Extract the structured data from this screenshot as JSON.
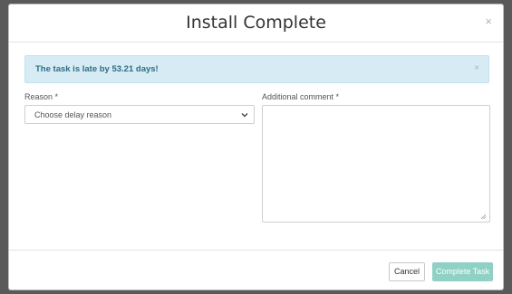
{
  "modal": {
    "title": "Install Complete",
    "close_glyph": "×"
  },
  "alert": {
    "message": "The task is late by 53.21 days!",
    "close_glyph": "×",
    "background_color": "#d6ebf3",
    "text_color": "#2e6d86"
  },
  "form": {
    "reason_label": "Reason *",
    "reason_selected": "Choose delay reason",
    "comment_label": "Additional comment *",
    "comment_value": ""
  },
  "footer": {
    "cancel_label": "Cancel",
    "complete_label": "Complete Task",
    "complete_color": "#8fd1c5"
  },
  "icons": {
    "select_chevron": "chevron-down-icon",
    "textarea_grip": "resize-grip-icon"
  }
}
